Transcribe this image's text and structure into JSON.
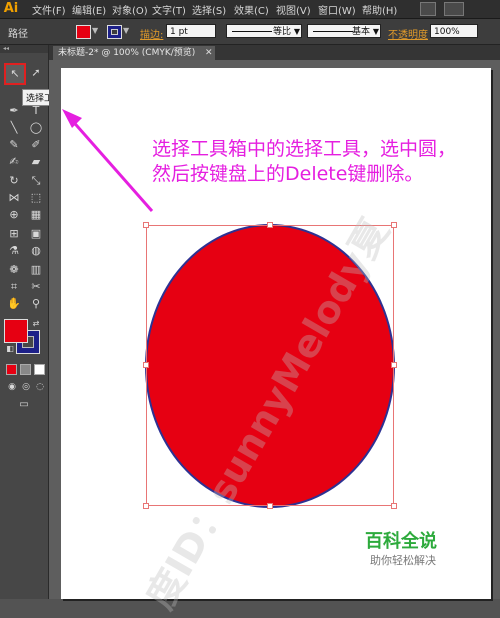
{
  "app": {
    "logo": "Ai"
  },
  "menu": {
    "items": [
      "文件(F)",
      "编辑(E)",
      "对象(O)",
      "文字(T)",
      "选择(S)",
      "效果(C)",
      "视图(V)",
      "窗口(W)",
      "帮助(H)"
    ]
  },
  "controlbar": {
    "path_label": "路径",
    "stroke_label": "描边:",
    "stroke_weight": "1 pt",
    "profile_label": "等比",
    "brush_label": "基本",
    "opacity_label": "不透明度",
    "opacity_value": "100%"
  },
  "colors": {
    "fill": "#e60012",
    "stroke": "#1d2088",
    "annotation": "#e51fe0",
    "brand": "#2daa3c"
  },
  "tools": {
    "tooltip": "选择工具 (V)",
    "icons": [
      "selection-icon",
      "direct-selection-icon",
      "magic-wand-icon",
      "lasso-icon",
      "pen-icon",
      "type-icon",
      "line-icon",
      "ellipse-icon",
      "paintbrush-icon",
      "pencil-icon",
      "blob-brush-icon",
      "eraser-icon",
      "rotate-icon",
      "scale-icon",
      "width-icon",
      "free-transform-icon",
      "shape-builder-icon",
      "perspective-icon",
      "mesh-icon",
      "gradient-icon",
      "eyedropper-icon",
      "blend-icon",
      "symbol-sprayer-icon",
      "column-graph-icon",
      "artboard-icon",
      "slice-icon",
      "hand-icon",
      "zoom-icon"
    ]
  },
  "document": {
    "tab_title": "未标题-2* @ 100% (CMYK/预览)"
  },
  "annotation": {
    "line1": "选择工具箱中的选择工具，选中圆，",
    "line2": "然后按键盘上的Delete键删除。"
  },
  "watermark": "度ID：sunnyMelody夏",
  "brand": {
    "title": "百科全说",
    "subtitle": "助你轻松解决"
  }
}
